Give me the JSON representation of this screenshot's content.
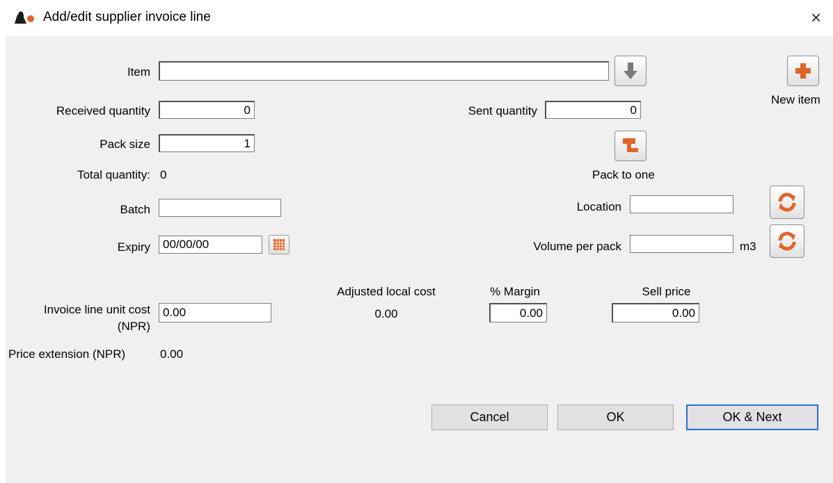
{
  "window": {
    "title": "Add/edit supplier invoice line",
    "close_glyph": "×",
    "icon": "app-logo-icon"
  },
  "item": {
    "label": "Item",
    "value": "",
    "lookup_icon": "arrow-down-icon"
  },
  "new_item": {
    "label": "New item",
    "icon": "plus-icon"
  },
  "received_quantity": {
    "label": "Received quantity",
    "value": "0"
  },
  "sent_quantity": {
    "label": "Sent quantity",
    "value": "0"
  },
  "pack_size": {
    "label": "Pack size",
    "value": "1"
  },
  "pack_to_one": {
    "label": "Pack to one",
    "icon": "pack-to-one-icon"
  },
  "total_quantity": {
    "label": "Total quantity:",
    "value": "0"
  },
  "batch": {
    "label": "Batch",
    "value": ""
  },
  "location": {
    "label": "Location",
    "value": "",
    "icon": "refresh-icon"
  },
  "expiry": {
    "label": "Expiry",
    "value": "00/00/00",
    "icon": "calendar-icon"
  },
  "volume_per_pack": {
    "label": "Volume per pack",
    "value": "",
    "unit": "m3",
    "icon": "refresh-icon"
  },
  "invoice_line_unit_cost": {
    "label_line1": "Invoice line unit cost",
    "label_line2": "(NPR)",
    "value": "0.00"
  },
  "adjusted_local_cost": {
    "label": "Adjusted local cost",
    "value": "0.00"
  },
  "margin": {
    "label": "% Margin",
    "value": "0.00"
  },
  "sell_price": {
    "label": "Sell price",
    "value": "0.00"
  },
  "price_extension": {
    "label": "Price extension (NPR)",
    "value": "0.00"
  },
  "buttons": {
    "cancel": "Cancel",
    "ok": "OK",
    "ok_next": "OK & Next"
  },
  "colors": {
    "accent_orange": "#e0652a",
    "default_button_border": "#2a6fd6",
    "dialog_bg": "#f0f0f0"
  }
}
